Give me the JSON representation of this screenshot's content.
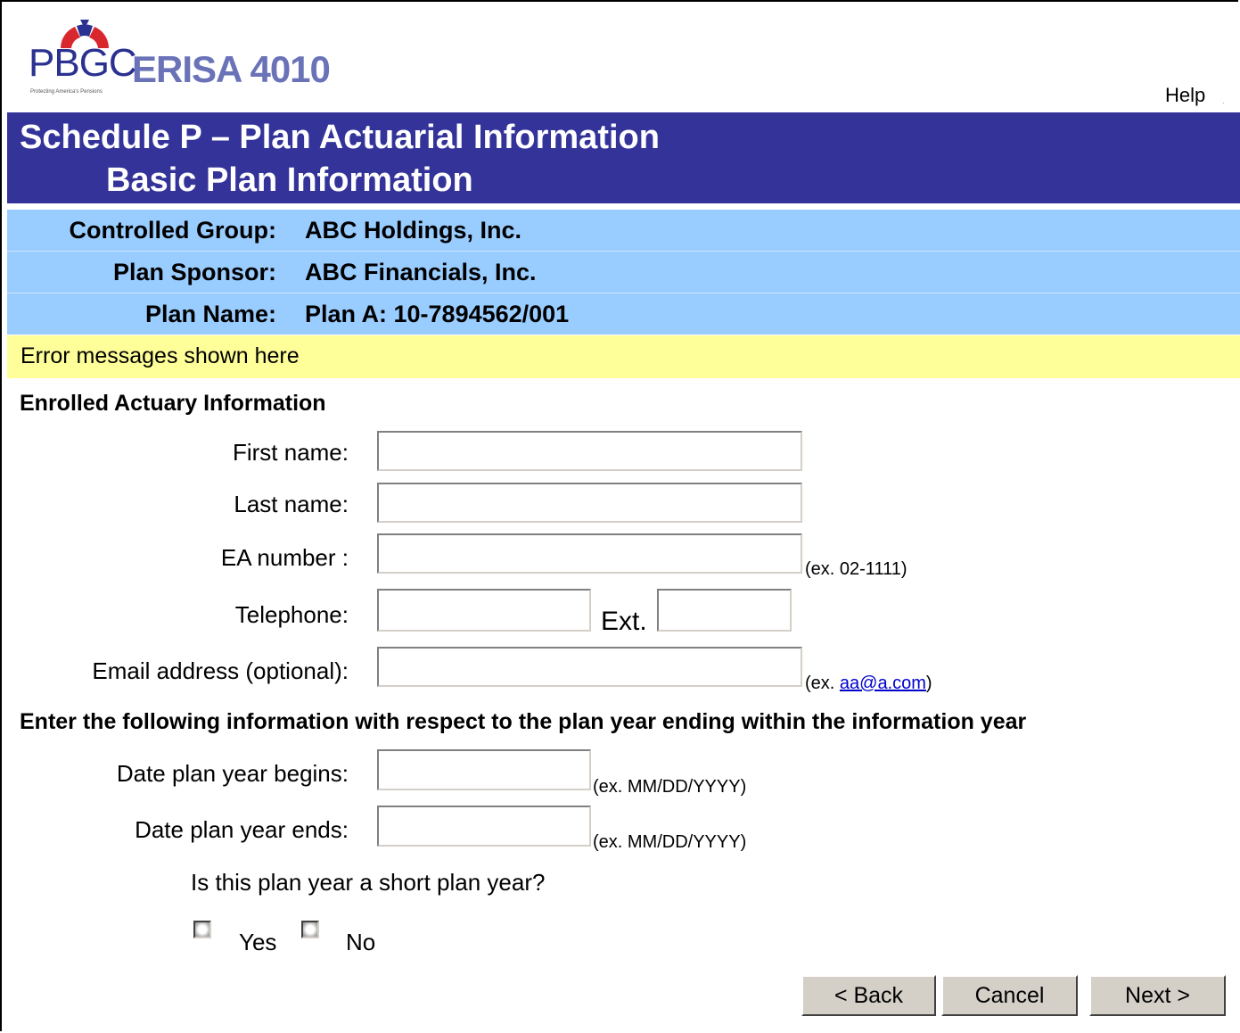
{
  "header": {
    "logo_text_pbgc": "PBGC",
    "logo_text_erisa": "ERISA 4010",
    "logo_tagline": "Protecting America's Pensions",
    "help_label": "Help",
    "title_line1": "Schedule P – Plan Actuarial Information",
    "title_line2": "Basic Plan Information",
    "title_bar_color": "#333399"
  },
  "plan_info": {
    "controlled_group_label": "Controlled Group:",
    "controlled_group_value": "ABC Holdings, Inc.",
    "plan_sponsor_label": "Plan Sponsor:",
    "plan_sponsor_value": "ABC Financials, Inc.",
    "plan_name_label": "Plan Name:",
    "plan_name_value": "Plan A: 10-7894562/001",
    "row_color": "#99ccff"
  },
  "error_bar": {
    "message": "Error messages shown here",
    "color": "#ffff99"
  },
  "actuary": {
    "section_title": "Enrolled Actuary Information",
    "first_name_label": "First name:",
    "first_name_value": "",
    "last_name_label": "Last name:",
    "last_name_value": "",
    "ea_number_label": "EA number :",
    "ea_number_value": "",
    "ea_number_hint": "(ex. 02-1111)",
    "telephone_label": "Telephone:",
    "telephone_value": "",
    "ext_label": "Ext.",
    "ext_value": "",
    "email_label": "Email address (optional):",
    "email_value": "",
    "email_hint_prefix": "(ex. ",
    "email_hint_link": "aa@a.com",
    "email_hint_suffix": ")"
  },
  "plan_year": {
    "section_title": "Enter the following information with respect to the plan year ending within the information year",
    "begins_label": "Date plan year begins:",
    "begins_value": "",
    "begins_hint": "(ex. MM/DD/YYYY)",
    "ends_label": "Date plan year ends:",
    "ends_value": "",
    "ends_hint": "(ex. MM/DD/YYYY)",
    "short_year_question": "Is this plan year a short plan year?",
    "yes_label": "Yes",
    "no_label": "No"
  },
  "buttons": {
    "back_label": "< Back",
    "cancel_label": "Cancel",
    "next_label": "Next >"
  }
}
